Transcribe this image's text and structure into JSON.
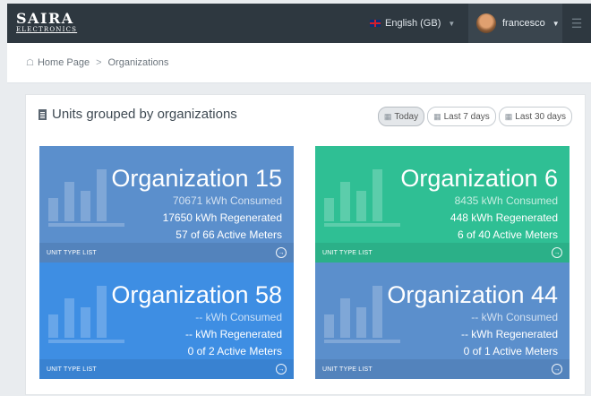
{
  "header": {
    "brand_line1": "SAIRA",
    "brand_line2": "ELECTRONICS",
    "language": "English (GB)",
    "username": "francesco"
  },
  "breadcrumb": {
    "home": "Home Page",
    "separator": ">",
    "current": "Organizations"
  },
  "panel": {
    "title": "Units grouped by organizations",
    "buttons": [
      "Today",
      "Last 7 days",
      "Last 30 days"
    ],
    "active_button": "Today"
  },
  "cards": [
    {
      "name": "Organization 15",
      "consumed": "70671 kWh Consumed",
      "regenerated": "17650 kWh Regenerated",
      "meters": "57 of 66 Active Meters",
      "footer": "UNIT TYPE LIST",
      "color": "#5b8fcc"
    },
    {
      "name": "Organization 6",
      "consumed": "8435 kWh Consumed",
      "regenerated": "448 kWh Regenerated",
      "meters": "6 of 40 Active Meters",
      "footer": "UNIT TYPE LIST",
      "color": "#2fbf94"
    },
    {
      "name": "Organization 58",
      "consumed": "-- kWh Consumed",
      "regenerated": "-- kWh Regenerated",
      "meters": "0 of 2 Active Meters",
      "footer": "UNIT TYPE LIST",
      "color": "#3e8ee3"
    },
    {
      "name": "Organization 44",
      "consumed": "-- kWh Consumed",
      "regenerated": "-- kWh Regenerated",
      "meters": "0 of 1 Active Meters",
      "footer": "UNIT TYPE LIST",
      "color": "#5b8fcc"
    }
  ],
  "icons": {
    "flag": "uk-flag-icon",
    "home": "home-icon",
    "calendar": "calendar-icon",
    "building": "building-icon",
    "arrow": "arrow-circle-right-icon",
    "menu": "menu-icon"
  }
}
